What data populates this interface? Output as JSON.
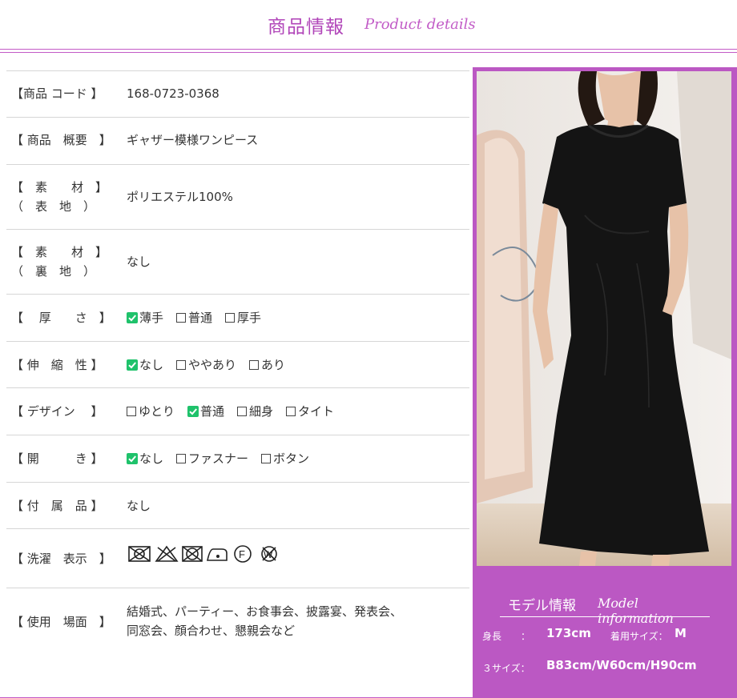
{
  "header": {
    "title_jp": "商品情報",
    "title_en": "Product details"
  },
  "rows": [
    {
      "label": "【商品 コード 】",
      "value": "168-0723-0368"
    },
    {
      "label": "【 商品　概要　】",
      "value": "ギャザー模様ワンピース"
    },
    {
      "label": "【　素　　材　】\n（　表　地　）",
      "value": "ポリエステル100%"
    },
    {
      "label": "【　素　　材　】\n（　裏　地　）",
      "value": "なし"
    },
    {
      "label": "【　 厚　　さ　】",
      "options": [
        {
          "text": "薄手",
          "checked": true
        },
        {
          "text": "普通",
          "checked": false
        },
        {
          "text": "厚手",
          "checked": false
        }
      ]
    },
    {
      "label": "【 伸　縮　性 】",
      "options": [
        {
          "text": "なし",
          "checked": true
        },
        {
          "text": "ややあり",
          "checked": false
        },
        {
          "text": "あり",
          "checked": false
        }
      ]
    },
    {
      "label": "【 デザイン 　】",
      "options": [
        {
          "text": "ゆとり",
          "checked": false
        },
        {
          "text": "普通",
          "checked": true
        },
        {
          "text": "細身",
          "checked": false
        },
        {
          "text": "タイト",
          "checked": false
        }
      ]
    },
    {
      "label": "【 開　　　き 】",
      "options": [
        {
          "text": "なし",
          "checked": true
        },
        {
          "text": "ファスナー",
          "checked": false
        },
        {
          "text": "ボタン",
          "checked": false
        }
      ]
    },
    {
      "label": "【 付　属　品 】",
      "value": "なし"
    },
    {
      "label": "【 洗濯　表示　】",
      "laundry_icons": [
        "no-tumble-dry-icon",
        "no-bleach-icon",
        "no-dry-clean-icon",
        "iron-low-icon",
        "dry-clean-f-icon",
        "no-wash-icon"
      ]
    },
    {
      "label": "【 使用　場面　】",
      "value_lines": [
        "結婚式、パーティー、お食事会、披露宴、発表会、",
        "同窓会、顔合わせ、懇親会など"
      ]
    }
  ],
  "model": {
    "title_jp": "モデル情報",
    "title_en": "Model information",
    "height_label": "身長　　：",
    "height_value": "173cm",
    "size_label": "着用サイズ：",
    "size_value": "M",
    "three_size_label": "３サイズ：",
    "three_size_value": "B83cm/W60cm/H90cm"
  },
  "colors": {
    "accent": "#bb58c3",
    "check": "#1fc26b",
    "dress": "#141414"
  }
}
